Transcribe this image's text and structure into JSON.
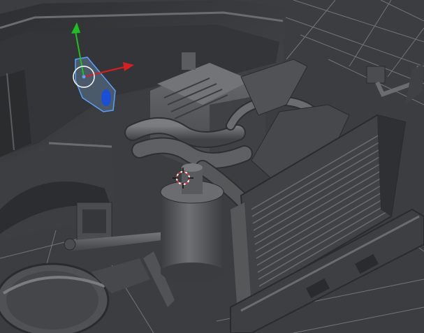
{
  "viewport": {
    "background": "#3b3d40",
    "grid_color": "#9ea3a8",
    "model_base_color": "#505255",
    "model_shadow_color": "#2a2b2d",
    "model_highlight_color": "#6c6e71",
    "selection_outline_color": "#5aa0ff",
    "gizmo": {
      "axis_y_color": "#1fbf1f",
      "axis_x_color": "#d81f1f",
      "selected_face_color": "#1a4fd8",
      "pivot_ring_color": "#ffffff",
      "icons": [
        "move-gizmo-y-arrow-icon",
        "move-gizmo-x-arrow-icon",
        "pivot-ring-icon"
      ]
    },
    "cursor": {
      "color": "#d83a3a",
      "icon": "crosshair-3d-cursor-icon"
    }
  }
}
